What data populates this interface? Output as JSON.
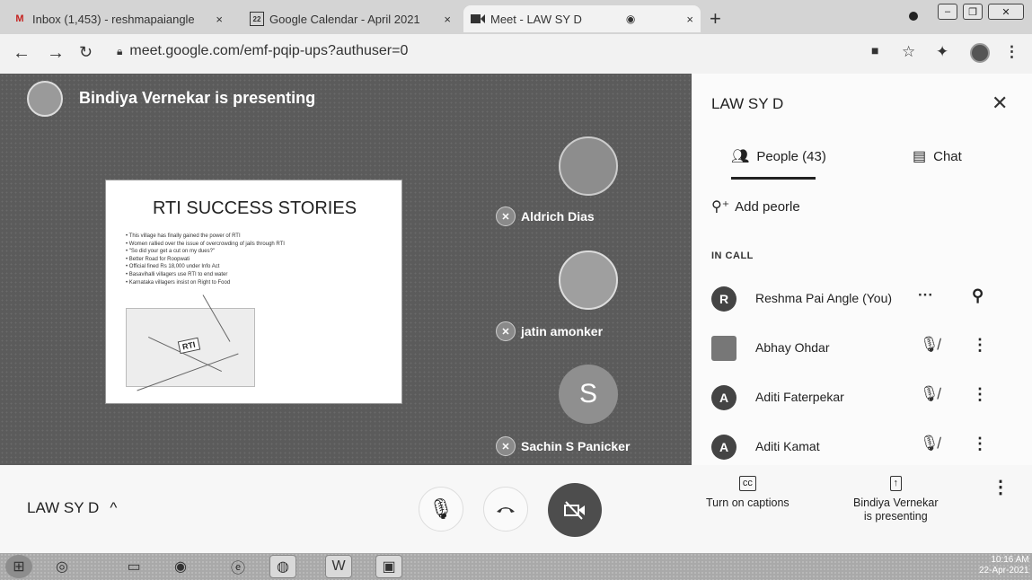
{
  "browser": {
    "tabs": [
      {
        "label": "Inbox (1,453) - reshmapaiangle",
        "icon": "gmail-icon",
        "close": "×",
        "active": false
      },
      {
        "label": "Google Calendar - April 2021",
        "icon": "calendar-icon",
        "icon_text": "22",
        "close": "×",
        "active": false
      },
      {
        "label": "Meet - LAW SY D",
        "icon": "meet-icon",
        "close": "×",
        "active": true
      }
    ],
    "new_tab": "+",
    "url": "meet.google.com/emf-pqip-ups?authuser=0"
  },
  "stage": {
    "banner": "Bindiya Vernekar is presenting",
    "slide": {
      "title": "RTI SUCCESS STORIES",
      "bullets": [
        "This village has finally gained the power of RTI",
        "Women rallied over the issue of overcrowding of jails through RTI",
        "\"So did your get a cut on my dues?\"",
        "Better Road for Roopwati",
        "Official fined Rs 18,000 under Info Act",
        "Basavihalli villagers use RTI to end water",
        "Karnataka villagers insist on Right to Food"
      ],
      "image_caption": "RTI"
    },
    "participants": [
      {
        "name": "Aldrich Dias"
      },
      {
        "name": "jatin amonker"
      },
      {
        "name": "Sachin S Panicker",
        "initial": "S"
      }
    ]
  },
  "controls": {
    "meeting_name": "LAW SY D",
    "expand": "^"
  },
  "panel": {
    "title": "LAW SY D",
    "tabs": {
      "people": "People (43)",
      "chat": "Chat"
    },
    "add_people": "Add peorle",
    "section_label": "IN CALL",
    "people": [
      {
        "name": "Reshma Pai Angle (You)",
        "initial": "R"
      },
      {
        "name": "Abhay Ohdar",
        "initial": ""
      },
      {
        "name": "Aditi Faterpekar",
        "initial": "A"
      },
      {
        "name": "Aditi Kamat",
        "initial": "A"
      }
    ],
    "footer": {
      "captions_icon": "cc",
      "captions_label": "Turn on captions",
      "presenting_label_1": "Bindiya Vernekar",
      "presenting_label_2": "is presenting"
    }
  },
  "taskbar": {
    "time": "10:16 AM",
    "date": "22-Apr-2021"
  }
}
